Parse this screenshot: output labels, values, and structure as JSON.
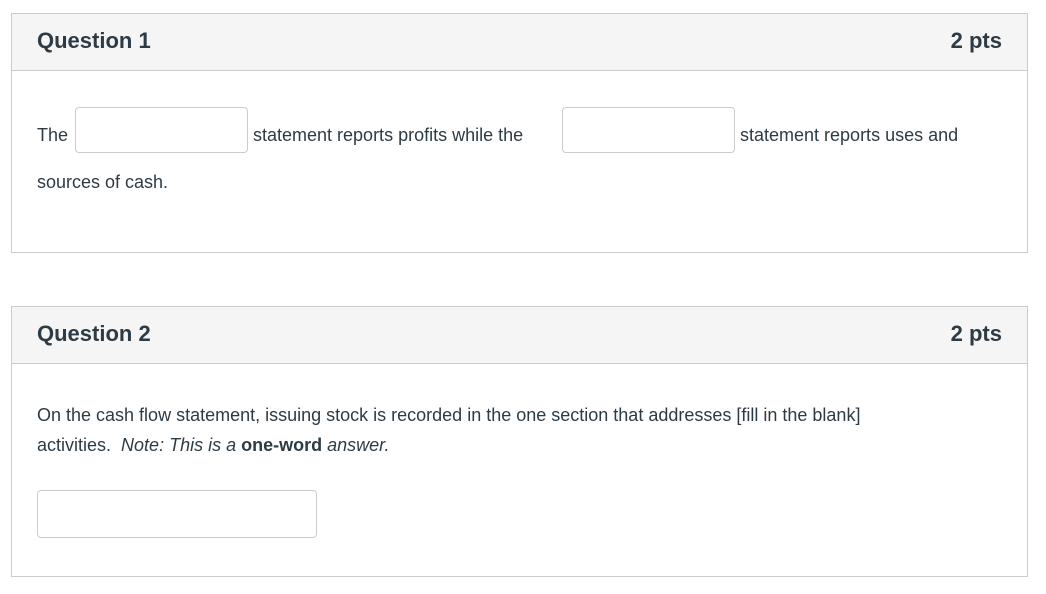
{
  "questions": [
    {
      "title": "Question 1",
      "points": "2 pts",
      "text_before_blank1": "The",
      "text_between_blanks": "statement reports profits while the",
      "text_after_blank2": "statement reports uses and",
      "text_line2": "sources of cash.",
      "blank1_value": "",
      "blank2_value": ""
    },
    {
      "title": "Question 2",
      "points": "2 pts",
      "prompt_line1": "On the cash flow statement, issuing stock is recorded in the one section that addresses [fill in the blank]",
      "prompt_line2_start": "activities.",
      "note_prefix": "Note:  This is a ",
      "note_bold": "one-word",
      "note_suffix": " answer.",
      "answer_value": ""
    }
  ]
}
